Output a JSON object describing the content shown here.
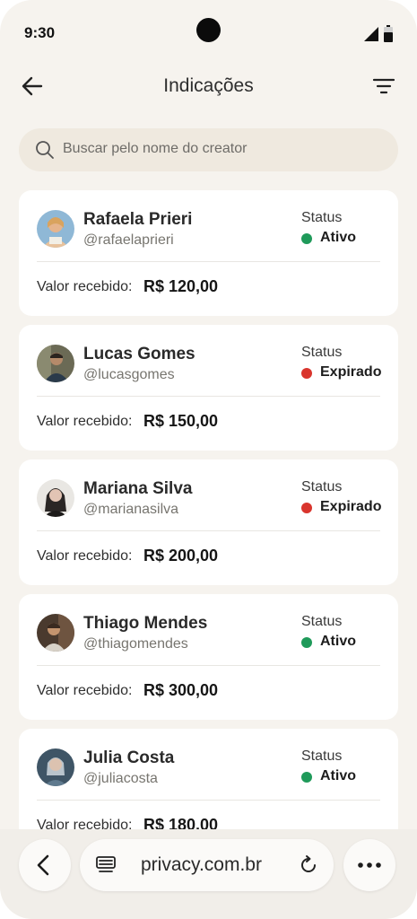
{
  "status_bar": {
    "time": "9:30"
  },
  "header": {
    "title": "Indicações"
  },
  "search": {
    "placeholder": "Buscar pelo nome do creator"
  },
  "card_labels": {
    "status": "Status",
    "value_received": "Valor recebido:"
  },
  "referrals": [
    {
      "name": "Rafaela Prieri",
      "handle": "@rafaelaprieri",
      "status": "Ativo",
      "amount": "R$ 120,00"
    },
    {
      "name": "Lucas Gomes",
      "handle": "@lucasgomes",
      "status": "Expirado",
      "amount": "R$ 150,00"
    },
    {
      "name": "Mariana Silva",
      "handle": "@marianasilva",
      "status": "Expirado",
      "amount": "R$ 200,00"
    },
    {
      "name": "Thiago Mendes",
      "handle": "@thiagomendes",
      "status": "Ativo",
      "amount": "R$ 300,00"
    },
    {
      "name": "Julia Costa",
      "handle": "@juliacosta",
      "status": "Ativo",
      "amount": "R$ 180,00"
    }
  ],
  "status_colors": {
    "Ativo": "#1f9a5a",
    "Expirado": "#d9352d"
  },
  "browser": {
    "url": "privacy.com.br"
  }
}
